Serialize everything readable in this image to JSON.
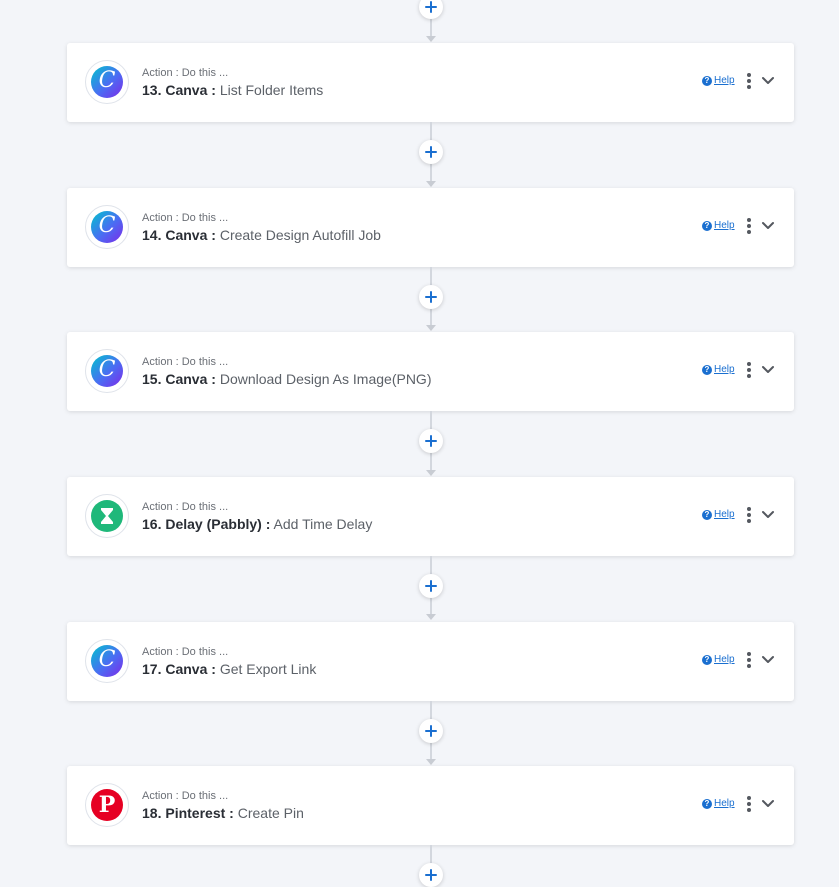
{
  "subtitle": "Action : Do this ...",
  "help_label": "Help",
  "steps": [
    {
      "number": "13.",
      "app": "Canva :",
      "action": "List Folder Items",
      "icon": "canva-icon"
    },
    {
      "number": "14.",
      "app": "Canva :",
      "action": "Create Design Autofill Job",
      "icon": "canva-icon"
    },
    {
      "number": "15.",
      "app": "Canva :",
      "action": "Download Design As Image(PNG)",
      "icon": "canva-icon"
    },
    {
      "number": "16.",
      "app": "Delay (Pabbly) :",
      "action": "Add Time Delay",
      "icon": "hourglass-icon"
    },
    {
      "number": "17.",
      "app": "Canva :",
      "action": "Get Export Link",
      "icon": "canva-icon"
    },
    {
      "number": "18.",
      "app": "Pinterest :",
      "action": "Create Pin",
      "icon": "pinterest-icon"
    }
  ],
  "colors": {
    "background": "#f3f5f9",
    "accent": "#1a6fd0",
    "connector": "#d3d7de",
    "canva_gradient_start": "#00c4cc",
    "canva_gradient_end": "#7d2ae8",
    "delay_green": "#1fb87a",
    "pinterest_red": "#e60023"
  }
}
